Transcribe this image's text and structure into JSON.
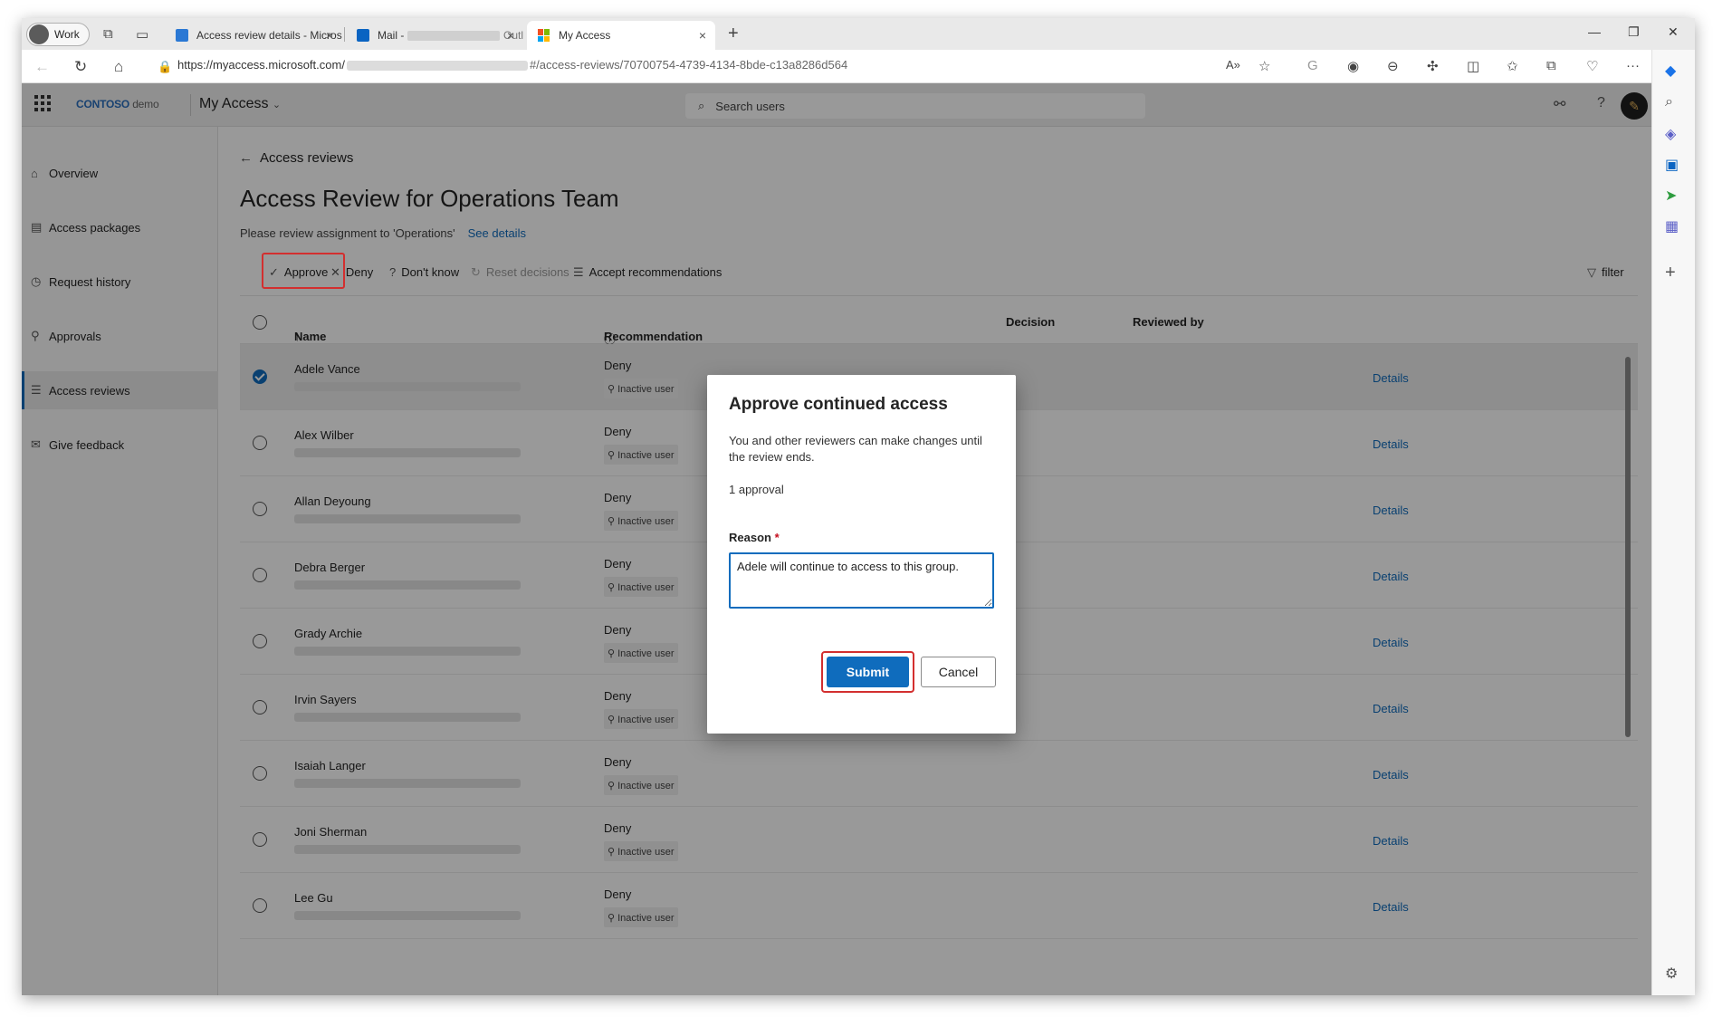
{
  "browser": {
    "profile_label": "Work",
    "tabs": [
      {
        "title": "Access review details - Microsoft",
        "active": false
      },
      {
        "title": "Mail -",
        "suffix": "Outl",
        "active": false
      },
      {
        "title": "My Access",
        "active": true
      }
    ],
    "url_prefix": "https://myaccess.microsoft.com/",
    "url_suffix": "#/access-reviews/70700754-4739-4134-8bde-c13a8286d564"
  },
  "app": {
    "logo_brand": "CONTOSO",
    "logo_suffix": "demo",
    "name": "My Access",
    "search_placeholder": "Search users"
  },
  "sidebar": {
    "items": [
      {
        "label": "Overview",
        "icon": "home-icon"
      },
      {
        "label": "Access packages",
        "icon": "package-icon"
      },
      {
        "label": "Request history",
        "icon": "history-icon"
      },
      {
        "label": "Approvals",
        "icon": "person-icon"
      },
      {
        "label": "Access reviews",
        "icon": "list-icon",
        "selected": true
      },
      {
        "label": "Give feedback",
        "icon": "feedback-icon"
      }
    ]
  },
  "page": {
    "back_label": "Access reviews",
    "title": "Access Review for Operations Team",
    "subtitle": "Please review assignment to 'Operations'",
    "see_details": "See details"
  },
  "toolbar": {
    "approve": "Approve",
    "deny": "Deny",
    "dont_know": "Don't know",
    "reset": "Reset decisions",
    "accept": "Accept recommendations",
    "filter": "filter"
  },
  "grid": {
    "headers": {
      "name": "Name",
      "recommendation": "Recommendation",
      "decision": "Decision",
      "reviewed_by": "Reviewed by"
    },
    "rows": [
      {
        "name": "Adele Vance",
        "recommendation": "Deny",
        "reason": "Inactive user",
        "details": "Details",
        "selected": true
      },
      {
        "name": "Alex Wilber",
        "recommendation": "Deny",
        "reason": "Inactive user",
        "details": "Details"
      },
      {
        "name": "Allan Deyoung",
        "recommendation": "Deny",
        "reason": "Inactive user",
        "details": "Details"
      },
      {
        "name": "Debra Berger",
        "recommendation": "Deny",
        "reason": "Inactive user",
        "details": "Details"
      },
      {
        "name": "Grady Archie",
        "recommendation": "Deny",
        "reason": "Inactive user",
        "details": "Details"
      },
      {
        "name": "Irvin Sayers",
        "recommendation": "Deny",
        "reason": "Inactive user",
        "details": "Details"
      },
      {
        "name": "Isaiah Langer",
        "recommendation": "Deny",
        "reason": "Inactive user",
        "details": "Details"
      },
      {
        "name": "Joni Sherman",
        "recommendation": "Deny",
        "reason": "Inactive user",
        "details": "Details"
      },
      {
        "name": "Lee Gu",
        "recommendation": "Deny",
        "reason": "Inactive user",
        "details": "Details"
      }
    ]
  },
  "dialog": {
    "title": "Approve continued access",
    "body": "You and other reviewers can make changes until the review ends.",
    "count": "1 approval",
    "reason_label": "Reason",
    "required_mark": "*",
    "reason_value": "Adele will continue to access to this group.",
    "submit": "Submit",
    "cancel": "Cancel"
  },
  "colors": {
    "accent": "#0f6cbd",
    "highlight": "#d32f2f"
  }
}
